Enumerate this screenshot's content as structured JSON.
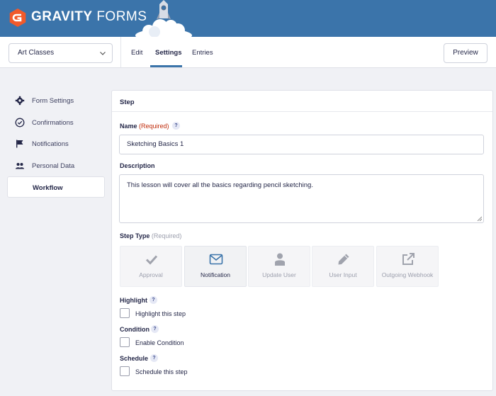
{
  "brand": {
    "name_bold": "GRAVITY",
    "name_light": " FORMS"
  },
  "toolbar": {
    "form_select_value": "Art Classes",
    "tabs": [
      {
        "label": "Edit"
      },
      {
        "label": "Settings",
        "active": true
      },
      {
        "label": "Entries"
      }
    ],
    "preview_label": "Preview"
  },
  "sidebar": {
    "items": [
      {
        "label": "Form Settings",
        "icon": "gear-icon"
      },
      {
        "label": "Confirmations",
        "icon": "check-circle-icon"
      },
      {
        "label": "Notifications",
        "icon": "flag-icon"
      },
      {
        "label": "Personal Data",
        "icon": "people-icon"
      },
      {
        "label": "Workflow",
        "active": true
      }
    ]
  },
  "panel": {
    "title": "Step",
    "name": {
      "label": "Name",
      "required": "(Required)",
      "value": "Sketching Basics 1"
    },
    "description": {
      "label": "Description",
      "value": "This lesson will cover all the basics regarding pencil sketching."
    },
    "step_type": {
      "label": "Step Type",
      "required": "(Required)",
      "selected": "Notification",
      "options": [
        {
          "label": "Approval",
          "icon": "checkmark-icon"
        },
        {
          "label": "Notification",
          "icon": "envelope-icon"
        },
        {
          "label": "Update User",
          "icon": "user-icon"
        },
        {
          "label": "User Input",
          "icon": "pencil-icon"
        },
        {
          "label": "Outgoing Webhook",
          "icon": "external-link-icon"
        }
      ]
    },
    "highlight": {
      "label": "Highlight",
      "checkbox_label": "Highlight this step",
      "checked": false
    },
    "condition": {
      "label": "Condition",
      "checkbox_label": "Enable Condition",
      "checked": false
    },
    "schedule": {
      "label": "Schedule",
      "checkbox_label": "Schedule this step",
      "checked": false
    },
    "help_glyph": "?"
  },
  "colors": {
    "header_bg": "#3b74aa",
    "accent": "#3b74aa",
    "required": "#c02b0a",
    "logo": "#f15a2b"
  }
}
